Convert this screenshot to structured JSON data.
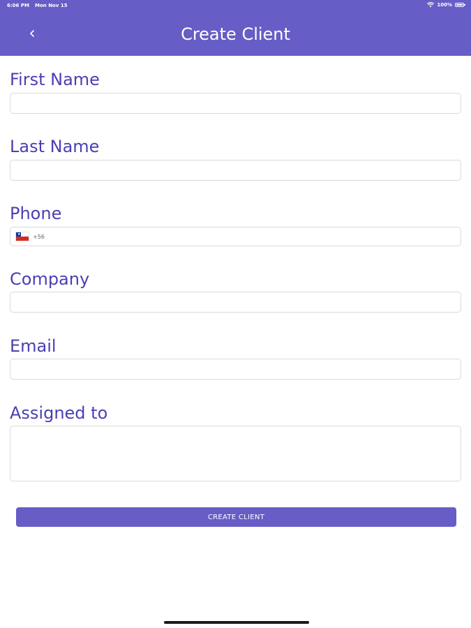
{
  "status_bar": {
    "time": "6:06 PM",
    "date": "Mon Nov 15",
    "battery": "100%"
  },
  "header": {
    "title": "Create Client",
    "back_icon": "chevron-left-icon",
    "background_color": "#675dc6"
  },
  "form": {
    "first_name": {
      "label": "First Name",
      "value": ""
    },
    "last_name": {
      "label": "Last Name",
      "value": ""
    },
    "phone": {
      "label": "Phone",
      "country_flag": "chile-flag-icon",
      "dial_code": "+56",
      "value": ""
    },
    "company": {
      "label": "Company",
      "value": ""
    },
    "email": {
      "label": "Email",
      "value": ""
    },
    "assigned_to": {
      "label": "Assigned to",
      "value": ""
    },
    "label_color": "#4a3fb4"
  },
  "submit": {
    "label": "CREATE CLIENT",
    "color": "#675dc6"
  }
}
